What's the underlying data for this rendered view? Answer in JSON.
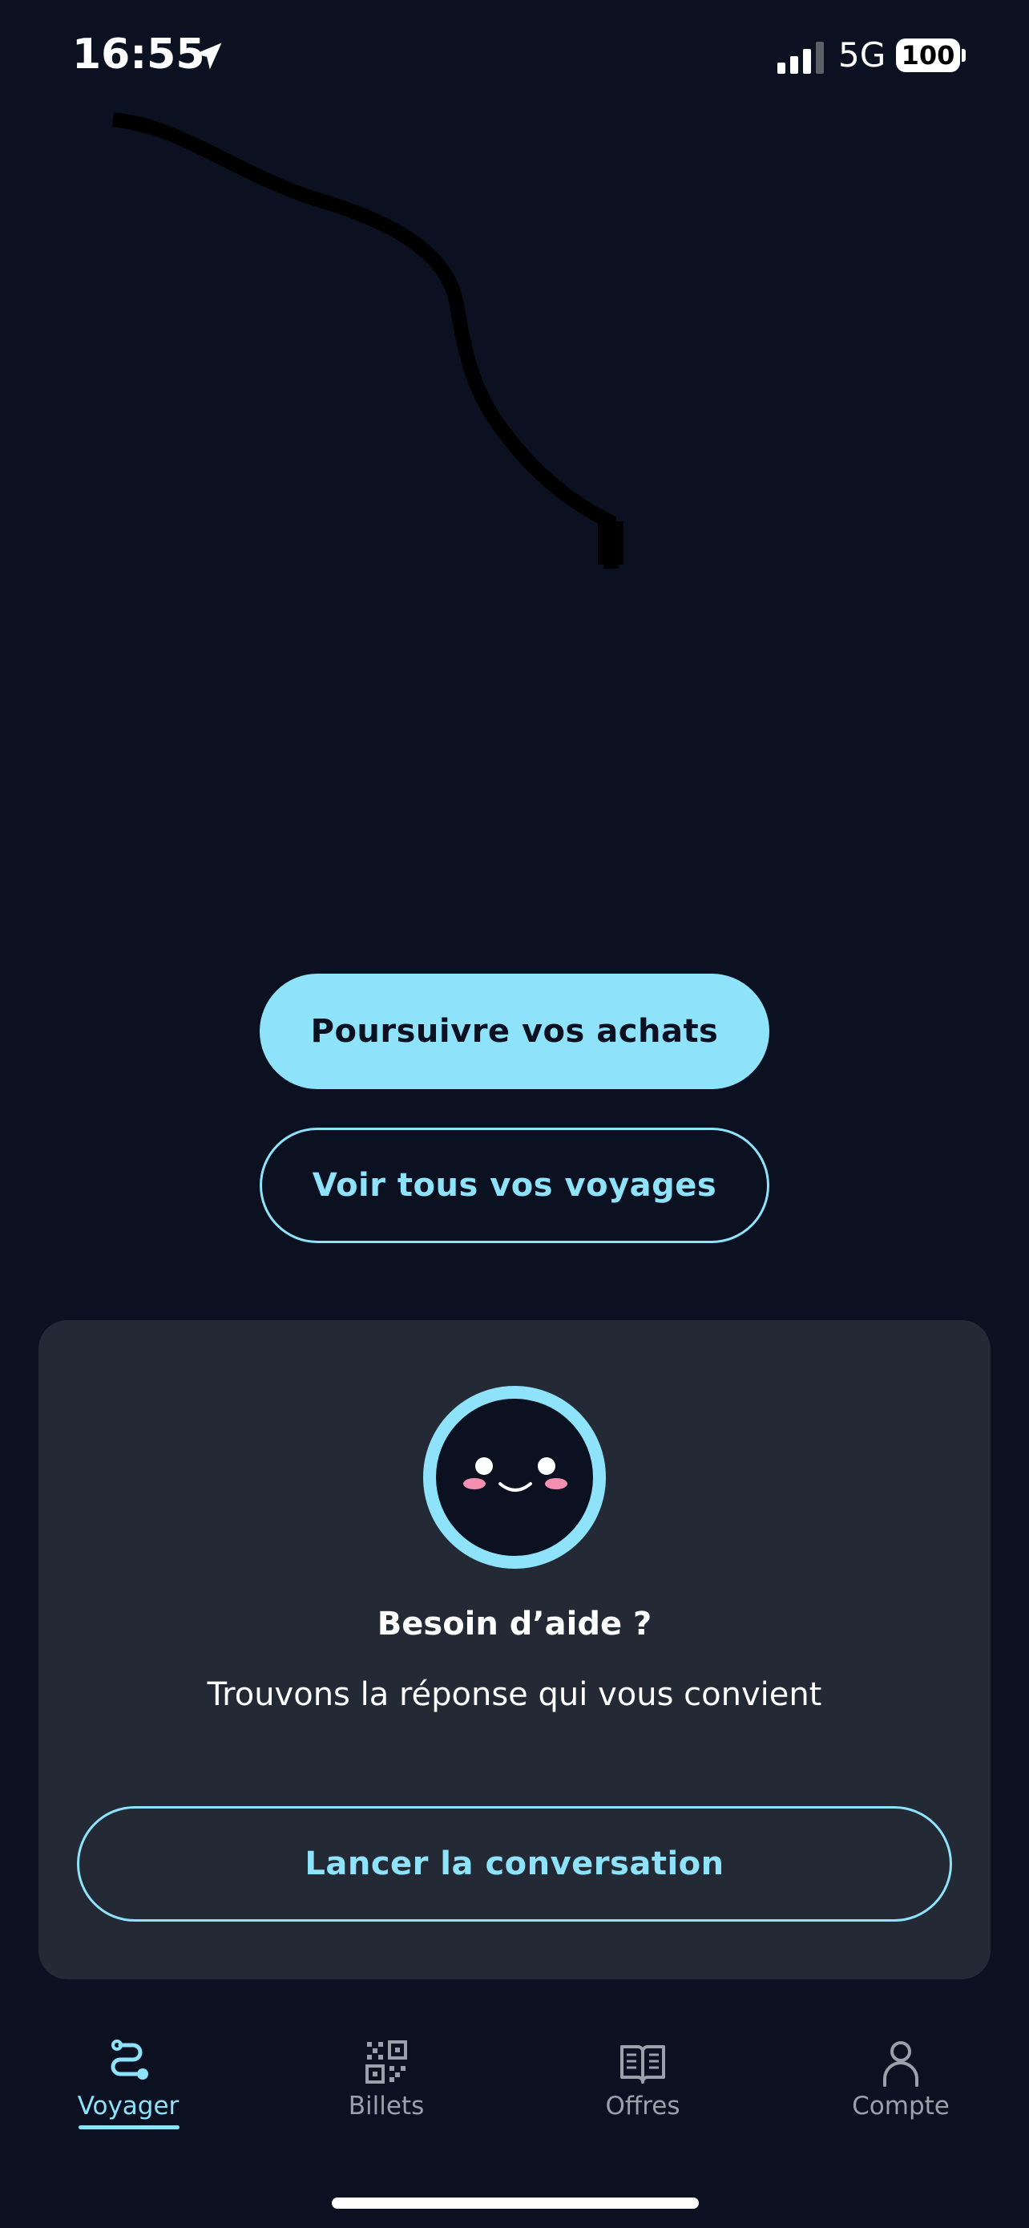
{
  "status_bar": {
    "time": "16:55",
    "network": "5G",
    "battery": "100"
  },
  "actions": {
    "continue_label": "Poursuivre vos achats",
    "trips_label": "Voir tous vos voyages"
  },
  "help": {
    "title": "Besoin d’aide ?",
    "subtitle": "Trouvons la réponse qui vous convient",
    "chat_label": "Lancer la conversation"
  },
  "tabs": [
    {
      "label": "Voyager",
      "icon": "route-icon",
      "active": true
    },
    {
      "label": "Billets",
      "icon": "qr-code-icon",
      "active": false
    },
    {
      "label": "Offres",
      "icon": "open-book-icon",
      "active": false
    },
    {
      "label": "Compte",
      "icon": "user-icon",
      "active": false
    }
  ],
  "colors": {
    "background": "#0b1120",
    "accent": "#8ee3fb",
    "card": "#232a36",
    "inactive": "#9aa1ab"
  }
}
